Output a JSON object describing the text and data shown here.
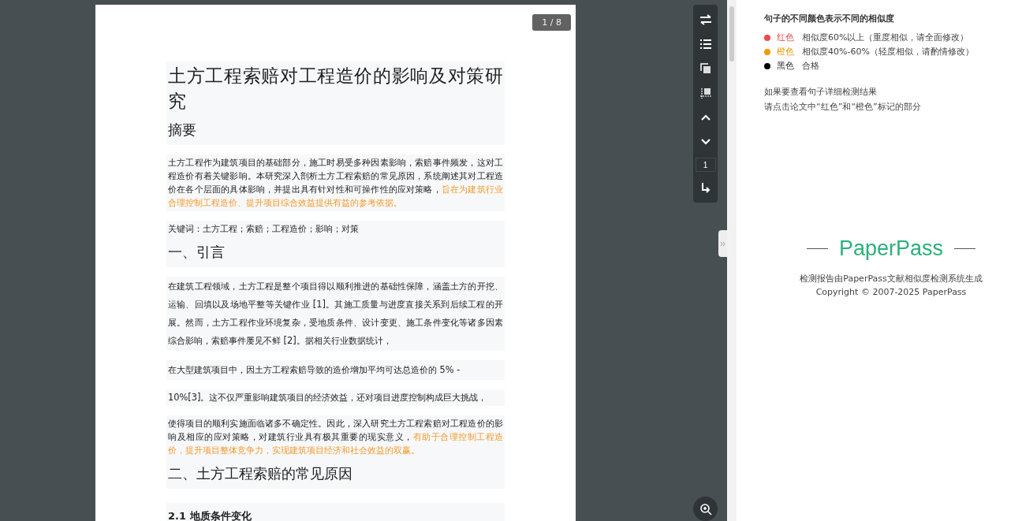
{
  "document": {
    "page_badge": "1 / 8",
    "blocks": [
      {
        "kind": "title",
        "segments": [
          {
            "text": "土方工程索赔对工程造价的影响及对策研究",
            "highlighted": false
          }
        ]
      },
      {
        "kind": "heading",
        "segments": [
          {
            "text": "摘要",
            "highlighted": false
          }
        ]
      },
      {
        "kind": "paragraph",
        "segments": [
          {
            "text": "土方工程作为建筑项目的基础部分，施工时易受多种因素影响，索赔事件频发，这对工程造价有着关键影响。本研究深入剖析土方工程索赔的常见原因，系统阐述其对工程造价在各个层面的具体影响，并提出具有针对性和可操作性的应对策略，",
            "highlighted": false
          },
          {
            "text": "旨在为建筑行业合理控制工程造价、提升项目综合效益提供有益的参考依据。",
            "highlighted": true
          }
        ]
      },
      {
        "kind": "paragraph",
        "segments": [
          {
            "text": "关键词：土方工程；索赔；工程造价；影响；对策",
            "highlighted": false
          }
        ]
      },
      {
        "kind": "heading",
        "segments": [
          {
            "text": "一、引言",
            "highlighted": false
          }
        ]
      },
      {
        "kind": "loose",
        "segments": [
          {
            "text": "在建筑工程领域，土方工程是整个项目得以顺利推进的基础性保障，涵盖土方的开挖、运输、回填以及场地平整等关键作业 [1]。其施工质量与进度直接关系到后续工程的开展。然而，土方工程作业环境复杂，受地质条件、设计变更、施工条件变化等诸多因素综合影响，索赔事件屡见不鲜 [2]。据相关行业数据统计，",
            "highlighted": false
          }
        ]
      },
      {
        "kind": "loose",
        "segments": [
          {
            "text": "在大型建筑项目中，因土方工程索赔导致的造价增加平均可达总造价的 5% -",
            "highlighted": false
          }
        ]
      },
      {
        "kind": "paragraph",
        "segments": [
          {
            "text": "10%[3]。这不仅严重影响建筑项目的经济效益，还对项目进度控制构成巨大挑战，",
            "highlighted": false
          }
        ]
      },
      {
        "kind": "paragraph",
        "segments": [
          {
            "text": "使得项目的顺利实施面临诸多不确定性。因此，深入研究土方工程索赔对工程造价的影响及相应的应对策略，对建筑行业具有极其重要的现实意义，",
            "highlighted": false
          },
          {
            "text": "有助于合理控制工程造价，提升项目整体竞争力，实现建筑项目经济和社会效益的双赢。",
            "highlighted": true
          }
        ]
      },
      {
        "kind": "heading",
        "segments": [
          {
            "text": "二、土方工程索赔的常见原因",
            "highlighted": false
          }
        ]
      },
      {
        "kind": "subheading",
        "segments": [
          {
            "text": "2.1  地质条件变化",
            "highlighted": false
          }
        ]
      }
    ]
  },
  "toolbar": {
    "items": [
      {
        "kind": "swap"
      },
      {
        "kind": "list"
      },
      {
        "kind": "copy"
      },
      {
        "kind": "crop"
      },
      {
        "kind": "up"
      },
      {
        "kind": "down"
      },
      {
        "kind": "page",
        "value": "1"
      },
      {
        "kind": "jump"
      }
    ]
  },
  "legend": {
    "title": "句子的不同颜色表示不同的相似度",
    "items": [
      {
        "color": "#e84c4c",
        "name": "红色",
        "description": "相似度60%以上（重度相似，请全面修改）"
      },
      {
        "color": "#f39800",
        "name": "橙色",
        "description": "相似度40%-60%（轻度相似，请酌情修改）"
      },
      {
        "color": "#000000",
        "name": "黑色",
        "description": "合格"
      }
    ],
    "notes": [
      "如果要查看句子详细检测结果",
      "请点击论文中“红色”和“橙色”标记的部分"
    ]
  },
  "brand": {
    "logo": "PaperPass",
    "footer": [
      "检测报告由PaperPass文献相似度检测系统生成",
      "Copyright © 2007-2025 PaperPass"
    ]
  }
}
